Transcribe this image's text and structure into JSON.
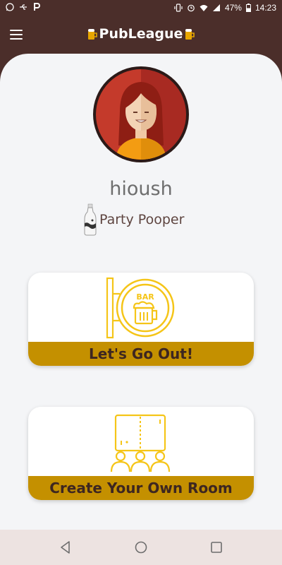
{
  "status_bar": {
    "battery": "47%",
    "time": "14:23"
  },
  "app_bar": {
    "title": "PubLeague"
  },
  "profile": {
    "username": "hioush",
    "rank": "Party Pooper"
  },
  "cards": {
    "go_out_label": "Let's Go Out!",
    "bar_sign_text": "BAR",
    "create_room_label": "Create Your Own Room"
  },
  "colors": {
    "primary_brown": "#4b2e2a",
    "accent_gold": "#c49000",
    "icon_yellow": "#f5c518",
    "background": "#f4f5f7"
  },
  "icons": {
    "status_left": [
      "whatsapp-icon",
      "usb-icon",
      "p-app-icon"
    ],
    "status_right": [
      "vibrate-icon",
      "alarm-icon",
      "wifi-icon",
      "signal-icon",
      "battery-icon"
    ],
    "nav": [
      "back-icon",
      "home-icon",
      "recents-icon"
    ]
  }
}
